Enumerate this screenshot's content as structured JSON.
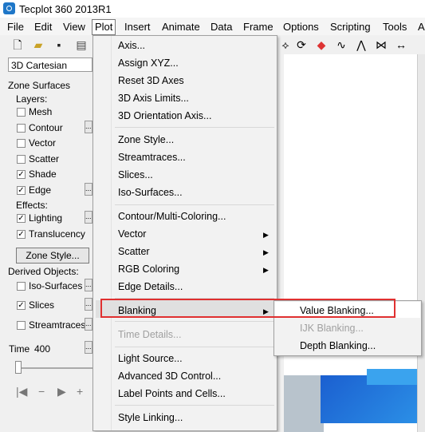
{
  "window": {
    "title": "Tecplot 360 2013R1"
  },
  "menubar": {
    "items": [
      "File",
      "Edit",
      "View",
      "Plot",
      "Insert",
      "Animate",
      "Data",
      "Frame",
      "Options",
      "Scripting",
      "Tools",
      "A"
    ]
  },
  "left_panel": {
    "mode": "3D Cartesian",
    "zone_surfaces_label": "Zone Surfaces",
    "layers_label": "Layers:",
    "layers": [
      {
        "label": "Mesh",
        "checked": false
      },
      {
        "label": "Contour",
        "checked": false
      },
      {
        "label": "Vector",
        "checked": false
      },
      {
        "label": "Scatter",
        "checked": false
      },
      {
        "label": "Shade",
        "checked": true
      },
      {
        "label": "Edge",
        "checked": true
      }
    ],
    "effects_label": "Effects:",
    "effects": [
      {
        "label": "Lighting",
        "checked": true
      },
      {
        "label": "Translucency",
        "checked": true
      }
    ],
    "zone_style_button": "Zone Style...",
    "derived_label": "Derived Objects:",
    "derived": [
      {
        "label": "Iso-Surfaces",
        "checked": false
      },
      {
        "label": "Slices",
        "checked": true
      },
      {
        "label": "Streamtraces",
        "checked": false
      }
    ],
    "time_label": "Time",
    "time_value": "400",
    "dot_button": "..."
  },
  "plot_menu": {
    "items": [
      "Axis...",
      "Assign XYZ...",
      "Reset 3D Axes",
      "3D Axis Limits...",
      "3D Orientation Axis...",
      "Zone Style...",
      "Streamtraces...",
      "Slices...",
      "Iso-Surfaces...",
      "Contour/Multi-Coloring...",
      "Vector",
      "Scatter",
      "RGB Coloring",
      "Edge Details...",
      "Blanking",
      "Time Details...",
      "Light Source...",
      "Advanced 3D Control...",
      "Label Points and Cells...",
      "Style Linking..."
    ],
    "submenu_arrow": "▶"
  },
  "blanking_submenu": {
    "items": [
      "Value Blanking...",
      "IJK Blanking...",
      "Depth Blanking..."
    ],
    "disabled": [
      "IJK Blanking..."
    ]
  },
  "colors": {
    "annotation_red": "#e03030",
    "highlight": "#e0e0e0"
  }
}
